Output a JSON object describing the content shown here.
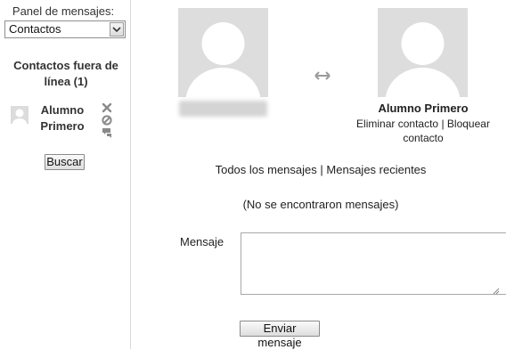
{
  "sidebar": {
    "panel_label": "Panel de mensajes:",
    "panel_select": {
      "selected": "Contactos"
    },
    "offline_heading": "Contactos fuera de línea (1)",
    "contacts": [
      {
        "name": "Alumno Primero"
      }
    ],
    "search_button": "Buscar"
  },
  "main": {
    "contact": {
      "name": "Alumno Primero",
      "remove_link": "Eliminar contacto",
      "separator": "|",
      "block_link": "Bloquear contacto"
    },
    "nav": {
      "all_messages": "Todos los mensajes",
      "separator": "|",
      "recent_messages": "Mensajes recientes"
    },
    "no_messages_text": "(No se encontraron mensajes)",
    "compose": {
      "label": "Mensaje",
      "value": "",
      "send_button": "Enviar mensaje"
    }
  },
  "icons": {
    "select_arrow": "chevron-down-icon",
    "remove": "close-icon",
    "block": "block-icon",
    "history": "message-history-icon",
    "swap": "swap-icon",
    "avatar": "user-avatar-icon"
  },
  "colors": {
    "avatar_bg": "#dddddd",
    "icon_gray": "#8a8a8a",
    "divider": "#dadada"
  }
}
